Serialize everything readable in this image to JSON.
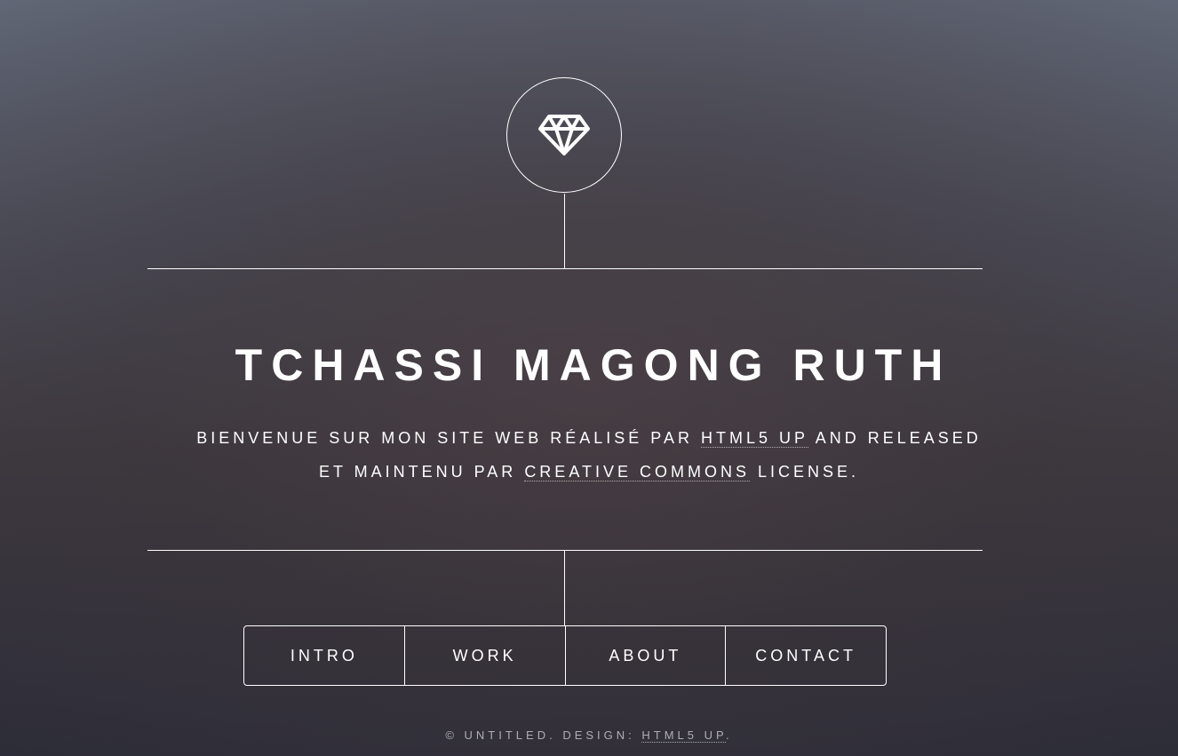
{
  "header": {
    "logo_icon": "diamond-icon"
  },
  "main": {
    "title": "TCHASSI MAGONG RUTH",
    "subtitle": {
      "line1_text_1": "BIENVENUE SUR MON SITE WEB RÉALISÉ PAR ",
      "line1_link": "HTML5 UP",
      "line1_text_2": " AND RELEASED",
      "line2_text_1": "ET MAINTENU PAR ",
      "line2_link": "CREATIVE COMMONS",
      "line2_text_2": " LICENSE."
    }
  },
  "nav": {
    "items": [
      {
        "label": "INTRO"
      },
      {
        "label": "WORK"
      },
      {
        "label": "ABOUT"
      },
      {
        "label": "CONTACT"
      }
    ]
  },
  "footer": {
    "copyright_text": "© UNTITLED. DESIGN: ",
    "design_link": "HTML5 UP",
    "end": "."
  },
  "colors": {
    "foreground": "#ffffff",
    "background_top": "#616776",
    "background_bottom": "#2b2c38"
  }
}
